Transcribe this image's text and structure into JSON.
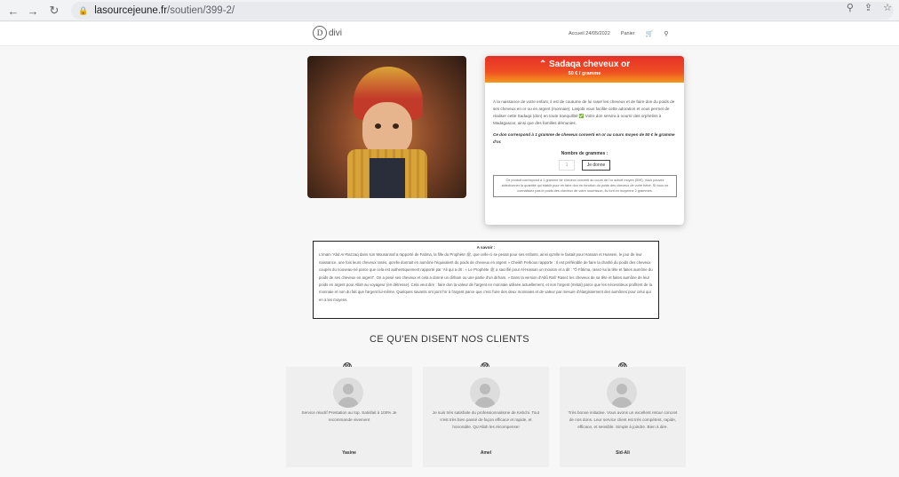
{
  "browser": {
    "url_host": "lasourcejeune.fr",
    "url_path": "/soutien/399-2/"
  },
  "header": {
    "logo_text": "divi",
    "menu": [
      "Accueil 24/05/2022",
      "Panier"
    ]
  },
  "product": {
    "title": "⌃ Sadaqa cheveux or",
    "price": "50 € / gramme",
    "description": "À la naissance de votre enfant, il est de coutume de lui raser les cheveux et de faire don du poids de ses cheveux en or ou en argent (monnaie). Lasjobi vous facilite cette adoration et vous permet de réaliser cette Sadaqa (don) en toute tranquillité ✅ Votre don servira à nourrir des orphelins à Madagascar, ainsi que des familles démunies.",
    "don_info": "Ce don correspond à 1 gramme de cheveux converti en or au cours moyen de 50 € le gramme d'or.",
    "qty_label": "Nombre de grammes :",
    "qty_value": "1",
    "button": "Je donne",
    "note": "Ce produit correspond à 1 gramme de cheveux converti au cours de l'or actuel moyen (50€). Vous pouvez sélectionner la quantité qui établir pour en faire don en fonction du poids des cheveux de votre bébé. Si vous ne connaissez pas le poids des cheveux de votre nourrisson, ils font en moyenne 2 grammes."
  },
  "info": {
    "title": "A savoir :",
    "body": "L'imam 'Abd Ar-Razzaq dans son Mousannaf a rapporté de Fatima, la fille du Prophète ﷺ, que celle-ci se pesait pour ses enfants, ainsi qu'elle le faisait pour Hassan et Hussein, le jour de leur naissance, une fois leurs cheveux rasés, qu'elle donnait en aumône l'équivalent du poids de cheveux en argent » Cheikh Ferkous rapporte : Il est préférable de faire la charité du poids des cheveux coupés du nouveau-né parce que cela est authentiquement rapporté par 'Ali qui a dit : « Le Prophète ﷺ a sacrifié pour Al-Hassan un mouton et a dit : \"Ô Fâtima, rasez-lui la tête et faites aumône du poids de ses cheveux en argent\". On a pesé ses cheveux et cela a donné un dirham ou une partie d'un dirham. » Dans la version d'Abû Rafi' Rasez les cheveux de sa tête et faites aumône de leur poids en argent pour Allah au voyageur (en détresse). Cela veut dire : faire don la valeur de l'argent en monnaie utilisée actuellement, et non l'argent (métal) parce que les nécessiteux profitent de la monnaie et non du fait que l'argent lui-même. Quelques savants ont joint l'or à l'argent parce que c'est l'une des deux monnaies et de valeur par mesure d'élargissement des aumônes pour celui qui en a les moyens."
  },
  "testimonials": {
    "section_title": "CE QU'EN DISENT NOS CLIENTS",
    "items": [
      {
        "text": "Service réactif Prestation au top. Satisfait à 100% Je recommande vivement",
        "name": "Yasine"
      },
      {
        "text": "Je suis très satisfaite du professionnalisme de Kebchi. Tout s'est très bien passé de façon efficace et rapide, et honorable. Qu'Allah les récompense!",
        "name": "Amel"
      },
      {
        "text": "Très bonne initiative. Vous avons un excellent retour concret de nos dons. Leur service client est très compétent, rapide, efficace, et sensible. Simple à joindre. Bien à dire.",
        "name": "Sid-Ali"
      }
    ]
  },
  "colors": {
    "accent_red": "#e53027",
    "accent_orange": "#f39a1e"
  }
}
